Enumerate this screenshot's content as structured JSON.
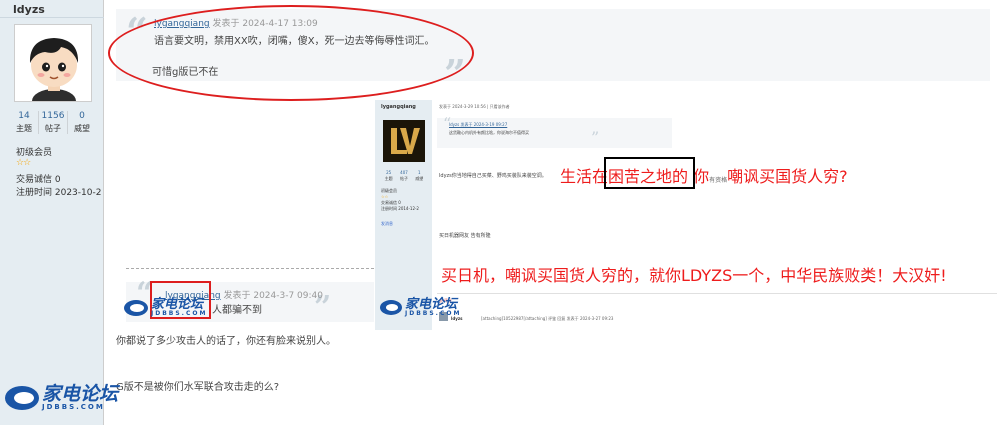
{
  "profile": {
    "username": "ldyzs",
    "stats": [
      {
        "value": "14",
        "label": "主题"
      },
      {
        "value": "1156",
        "label": "帖子"
      },
      {
        "value": "0",
        "label": "威望"
      }
    ],
    "level": "初级会员",
    "stars": "☆☆",
    "trust": "交易诚信 0",
    "register": "注册时间  2023-10-2"
  },
  "quote": {
    "author": "lygangqiang",
    "meta": " 发表于 2024-4-17 13:09",
    "text": "语言要文明，禁用XX吹，闭嘴，傻X，死一边去等侮辱性词汇。"
  },
  "post_line": "可惜g版已不在",
  "embedded": {
    "user": "lygangqiang",
    "post_head": "发表于 2024-3-29 10:56  |  只看该作者",
    "quote_author": "ldyzs 发表于 2024-3-19 09:27",
    "quote_text": "这货鞍心内机外有颜比啥，你说海尔不值得买",
    "stats_nums": [
      "25",
      "407",
      "1"
    ],
    "stats_labels": [
      "主题",
      "帖子",
      "威望"
    ],
    "meta": [
      "初级会员",
      "☆☆",
      "交易诚信 0",
      "注册时间 2014-12-2"
    ],
    "message_link": "发消息",
    "body1": "ldyzs你当地得自己买菜、野鸡买装队来装空调。",
    "body2": "买日机器网友 告有所隆",
    "votes": "◎ 评分",
    "bottom_user": "ldyzs",
    "bottom_attach": "[attaching]10522987[/attaching]   评鉴 回复  发表于 2024-3-27 09:23"
  },
  "annotations": {
    "line1_main": "生活在困苦之地的 你",
    "line1_small": "有资格",
    "line1_tail": "嘲讽买国货人穷?",
    "line2": "买日机，嘲讽买国货人穷的，就你LDYZS一个，中华民族败类！大汉奸!"
  },
  "quote2": {
    "author": "lygangqiang",
    "meta": " 发表于 2024-3-7 09:40",
    "text": "人都骗不到"
  },
  "paragraphs": [
    "你都说了多少攻击人的话了，你还有脸来说别人。",
    "G版不是被你们水军联合攻击走的么?"
  ],
  "watermark": {
    "brand": "家电论坛",
    "domain": "JDBBS.COM"
  },
  "colors": {
    "sidebar_bg": "#e5edf2",
    "link": "#336699",
    "annotation_red": "#ee1c1c",
    "watermark_blue": "#1a55a6"
  }
}
